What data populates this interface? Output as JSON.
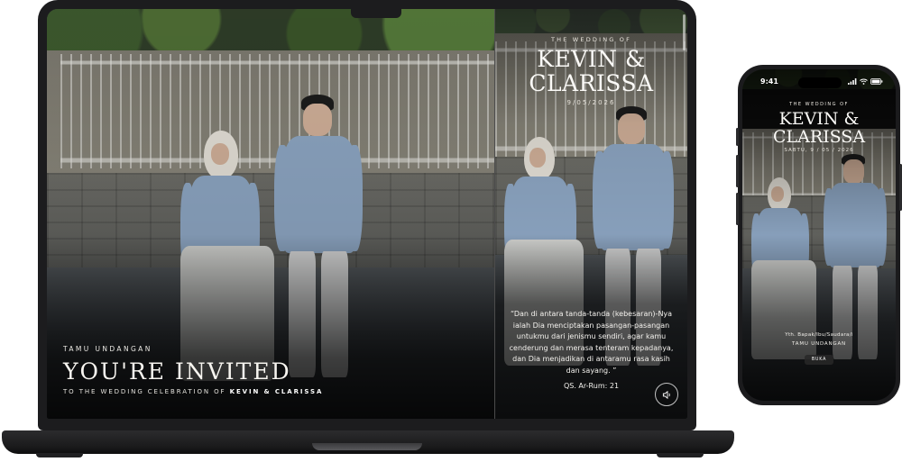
{
  "laptop": {
    "left": {
      "guest_label": "TAMU UNDANGAN",
      "title": "YOU'RE INVITED",
      "subtitle_prefix": "TO THE WEDDING CELEBRATION OF",
      "subtitle_names": "KEVIN & CLARISSA"
    },
    "right": {
      "overline": "THE WEDDING OF",
      "groom": "KEVIN &",
      "bride": "CLARISSA",
      "date": "9/05/2026",
      "verse": "“Dan di antara tanda-tanda (kebesaran)-Nya ialah Dia menciptakan pasangan-pasangan untukmu dari jenismu sendiri, agar kamu cenderung dan merasa tenteram kepadanya, dan Dia menjadikan di antaramu rasa kasih dan sayang. ”",
      "verse_ref": "QS. Ar-Rum: 21",
      "audio_icon": "speaker-icon"
    }
  },
  "phone": {
    "status_time": "9:41",
    "overline": "THE WEDDING OF",
    "groom": "KEVIN &",
    "bride": "CLARISSA",
    "date": "SABTU, 9 / 05 / 2026",
    "addressee": "Yth. Bapak/Ibu/Saudara/i",
    "guest_label": "TAMU UNDANGAN",
    "open_button": "BUKA"
  },
  "colors": {
    "device_frame": "#1c1c1e",
    "sweater": "#8ea7c4",
    "text": "#ffffff"
  }
}
